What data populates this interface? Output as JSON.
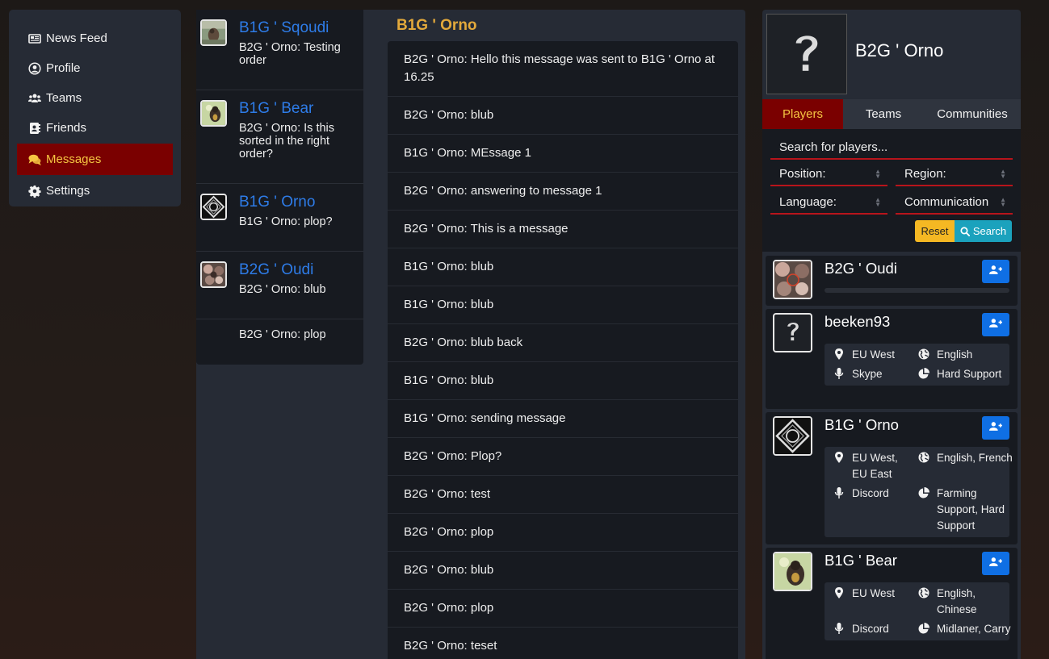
{
  "nav": {
    "items": [
      {
        "label": "News Feed",
        "icon": "newspaper-icon"
      },
      {
        "label": "Profile",
        "icon": "user-circle-icon"
      },
      {
        "label": "Teams",
        "icon": "users-icon"
      },
      {
        "label": "Friends",
        "icon": "address-book-icon"
      },
      {
        "label": "Messages",
        "icon": "comments-icon",
        "active": true
      },
      {
        "label": "Settings",
        "icon": "gear-icon"
      }
    ]
  },
  "conversations": [
    {
      "name": "B1G ' Sqoudi",
      "last": "B2G ' Orno: Testing order"
    },
    {
      "name": "B1G ' Bear",
      "last": "B2G ' Orno: Is this sorted in the right order?"
    },
    {
      "name": "B1G ' Orno",
      "last": "B1G ' Orno: plop?"
    },
    {
      "name": "B2G ' Oudi",
      "last": "B2G ' Orno: blub"
    },
    {
      "name": "",
      "last": "B2G ' Orno: plop"
    }
  ],
  "thread": {
    "title": "B1G ' Orno",
    "messages": [
      "B2G ' Orno: Hello this message was sent to B1G ' Orno at 16.25",
      "B2G ' Orno: blub",
      "B1G ' Orno: MEssage 1",
      "B2G ' Orno: answering to message 1",
      "B2G ' Orno: This is a message",
      "B1G ' Orno: blub",
      "B1G ' Orno: blub",
      "B2G ' Orno: blub back",
      "B1G ' Orno: blub",
      "B1G ' Orno: sending message",
      "B2G ' Orno: Plop?",
      "B2G ' Orno: test",
      "B2G ' Orno: plop",
      "B2G ' Orno: blub",
      "B2G ' Orno: plop",
      "B2G ' Orno: teset"
    ]
  },
  "profile": {
    "name": "B2G ' Orno"
  },
  "tabs": [
    "Players",
    "Teams",
    "Communities"
  ],
  "search": {
    "placeholder": "Search for players...",
    "position_label": "Position:",
    "region_label": "Region:",
    "language_label": "Language:",
    "communication_label": "Communication",
    "reset_label": "Reset",
    "search_label": "Search"
  },
  "players": [
    {
      "name": "B2G ' Oudi"
    },
    {
      "name": "beeken93",
      "region": "EU West",
      "language": "English",
      "comm": "Skype",
      "position": "Hard Support"
    },
    {
      "name": "B1G ' Orno",
      "region": "EU West, EU East",
      "language": "English, French",
      "comm": "Discord",
      "position": "Farming Support, Hard Support"
    },
    {
      "name": "B1G ' Bear",
      "region": "EU West",
      "language": "English, Chinese",
      "comm": "Discord",
      "position": "Midlaner, Carry"
    }
  ],
  "colors": {
    "accent_red": "#7a0000",
    "accent_gold": "#f5c542",
    "link_blue": "#2e7ce8",
    "thread_title": "#e3a93b",
    "add_button": "#0f6fe4",
    "reset_button": "#f5b823",
    "search_button": "#1ba2bd"
  }
}
